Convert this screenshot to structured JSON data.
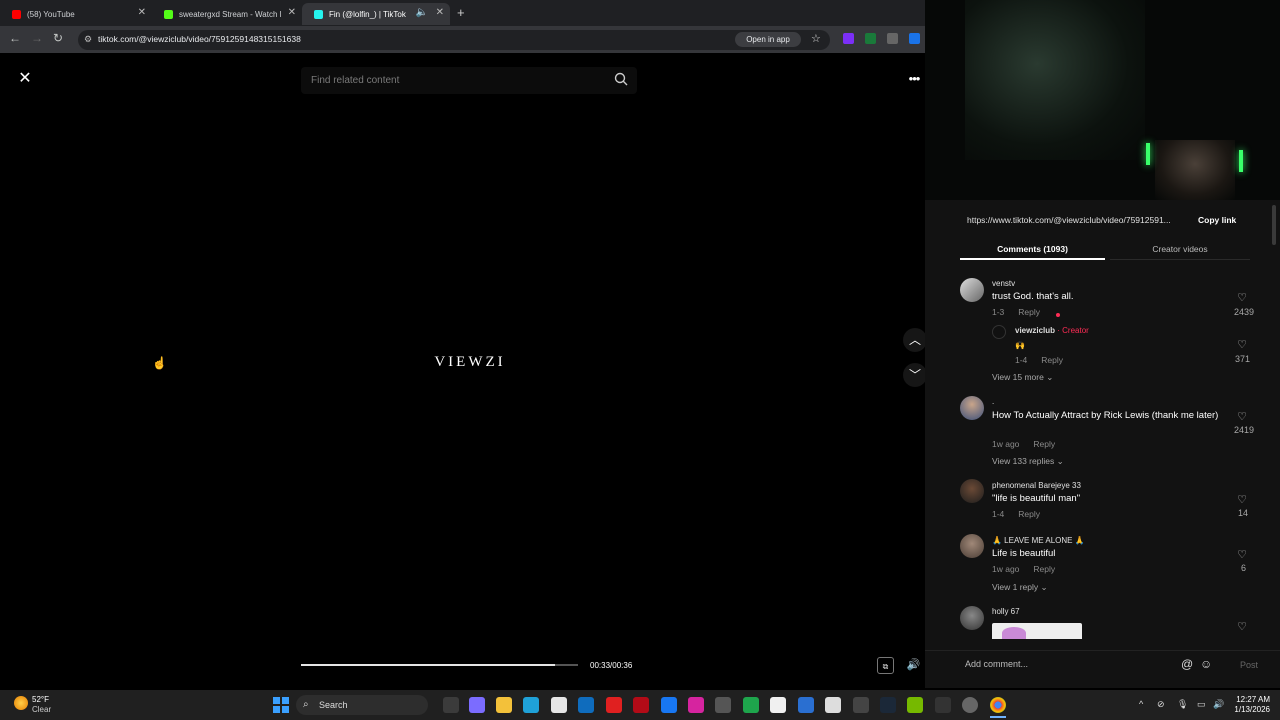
{
  "browser": {
    "tabs": [
      {
        "title": "(58) YouTube",
        "color": "#ff0000"
      },
      {
        "title": "sweatergxd Stream - Watch Li...",
        "color": "#53fc18"
      },
      {
        "title": "Fin (@lolfin_) | TikTok",
        "color": "#25f4ee"
      }
    ],
    "url": "tiktok.com/@viewziclub/video/7591259148315151638",
    "open_in_app": "Open in app"
  },
  "player": {
    "search_placeholder": "Find related content",
    "logo_text": "VIEWZI",
    "time": "00:33/00:36",
    "progress": 0.917
  },
  "panel": {
    "link": "https://www.tiktok.com/@viewziclub/video/75912591...",
    "copy_link": "Copy link",
    "tab_comments": "Comments (1093)",
    "tab_creator": "Creator videos",
    "reply_label": "Reply",
    "comments": [
      {
        "user": "venstv",
        "text": "trust God. that's all.",
        "date": "1-3",
        "likes": "2439",
        "reply": {
          "user": "viewziclub",
          "badge": "· Creator",
          "text": "🙌",
          "date": "1-4",
          "likes": "371"
        },
        "view_more": "View 15 more"
      },
      {
        "user": ".",
        "text": "How To Actually Attract by Rick Lewis (thank me later)",
        "date": "1w ago",
        "likes": "2419",
        "view_more": "View 133 replies"
      },
      {
        "user": "phenomenal Barejeye 33",
        "text": "\"life is beautiful man\"",
        "date": "1-4",
        "likes": "14"
      },
      {
        "user": "🙏 LEAVE ME ALONE 🙏",
        "text": "Life is beautiful",
        "date": "1w ago",
        "likes": "6",
        "view_more": "View 1 reply"
      },
      {
        "user": "holly 67",
        "text": "",
        "date": "",
        "likes": ""
      }
    ],
    "add_comment": "Add comment...",
    "post": "Post"
  },
  "taskbar": {
    "weather_temp": "52°F",
    "weather_desc": "Clear",
    "search": "Search",
    "time": "12:27 AM",
    "date": "1/13/2026"
  }
}
